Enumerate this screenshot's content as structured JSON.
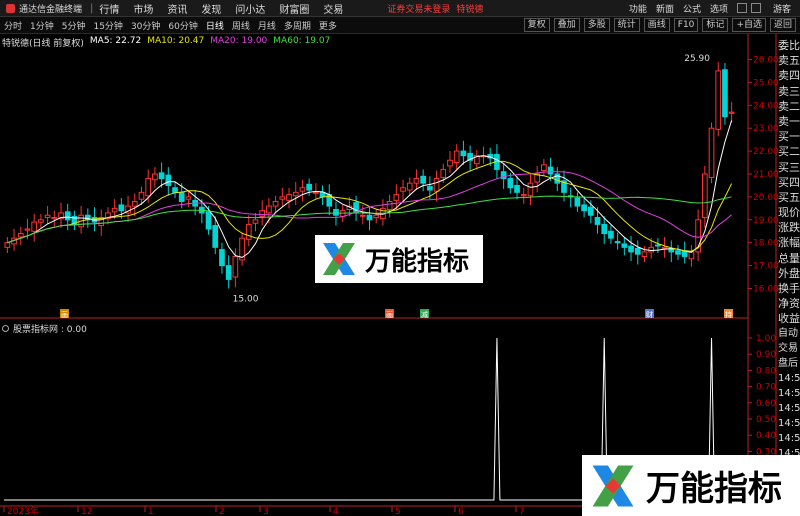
{
  "app": {
    "title": "通达信金融终端"
  },
  "menu": [
    "行情",
    "市场",
    "资讯",
    "发现",
    "问小达",
    "财富圈",
    "交易"
  ],
  "notice": {
    "text": "证券交易未登录",
    "link": "特锐德"
  },
  "tools": [
    "功能",
    "新面",
    "公式",
    "选项"
  ],
  "user": "游客",
  "periods": [
    "分时",
    "1分钟",
    "5分钟",
    "15分钟",
    "30分钟",
    "60分钟",
    "日线",
    "周线",
    "月线",
    "多周期",
    "更多"
  ],
  "active_period": "日线",
  "toolbar_right": [
    "复权",
    "叠加",
    "多股",
    "统计",
    "画线",
    "F10",
    "标记",
    "+自选",
    "返回"
  ],
  "legend": {
    "stock": "特锐德(日线 前复权)",
    "ma5": "MA5: 22.72",
    "ma10": "MA10: 20.47",
    "ma20": "MA20: 19.00",
    "ma60": "MA60: 19.07"
  },
  "colors": {
    "up": "#ff3232",
    "down": "#00d4d4",
    "ma5": "#ffffff",
    "ma10": "#e6e600",
    "ma20": "#e040e0",
    "ma60": "#40e040"
  },
  "chart_data": [
    {
      "type": "candlestick",
      "title": "特锐德(日线 前复权)",
      "ylim": [
        15.5,
        26.5
      ],
      "y_ticks": [
        "26.00",
        "25.00",
        "24.00",
        "23.00",
        "22.00",
        "21.00",
        "20.00",
        "19.00",
        "18.00",
        "17.00",
        "16.00"
      ],
      "annotations": [
        {
          "label": "25.90",
          "type": "max"
        },
        {
          "label": "15.00",
          "type": "min"
        }
      ],
      "series_close": [
        18.0,
        18.2,
        18.4,
        18.6,
        18.9,
        19.0,
        19.2,
        19.1,
        19.3,
        19.0,
        18.8,
        19.2,
        19.0,
        18.9,
        19.1,
        19.3,
        19.5,
        19.4,
        19.6,
        19.8,
        20.2,
        20.8,
        21.0,
        20.8,
        20.5,
        20.2,
        19.8,
        20.0,
        19.6,
        19.3,
        18.6,
        17.8,
        17.0,
        16.4,
        17.4,
        18.2,
        18.8,
        19.0,
        19.4,
        19.6,
        19.8,
        20.0,
        20.1,
        20.2,
        20.4,
        20.3,
        20.2,
        20.0,
        19.6,
        19.2,
        19.4,
        19.6,
        19.3,
        19.2,
        19.0,
        19.2,
        19.5,
        19.8,
        20.1,
        20.4,
        20.6,
        20.8,
        20.6,
        20.3,
        20.8,
        21.2,
        21.6,
        22.0,
        21.8,
        21.6,
        21.8,
        21.8,
        21.7,
        21.2,
        20.8,
        20.4,
        20.2,
        20.1,
        20.6,
        21.0,
        21.4,
        21.0,
        20.6,
        20.2,
        20.0,
        19.6,
        19.4,
        19.2,
        18.8,
        18.4,
        18.2,
        18.0,
        17.8,
        17.6,
        17.5,
        17.6,
        17.8,
        17.9,
        17.8,
        17.6,
        17.5,
        17.4,
        17.6,
        19.0,
        21.0,
        23.0,
        25.5,
        23.5,
        23.7
      ]
    },
    {
      "type": "line",
      "title": "股票指标网",
      "ylim": [
        0,
        1
      ],
      "y_ticks": [
        "1.00",
        "0.90",
        "0.80",
        "0.70",
        "0.60",
        "0.50",
        "0.40",
        "0.30",
        "0.20",
        "0.10"
      ],
      "value_label": "0.00",
      "spikes_at": [
        73,
        89,
        105
      ]
    }
  ],
  "x_axis": [
    "2023年",
    "12",
    "1",
    "2",
    "3",
    "4",
    "5",
    "6",
    "7"
  ],
  "indicator_label": "股票指标网 : 0.00",
  "right_labels": [
    "委比",
    "卖五",
    "卖四",
    "卖三",
    "卖二",
    "卖一",
    "买一",
    "买二",
    "买三",
    "买四",
    "买五",
    "现价",
    "涨跌",
    "涨幅",
    "总量",
    "外盘",
    "换手",
    "净资",
    "收益"
  ],
  "right_labels_2": [
    "自动",
    "交易",
    "盘后",
    "14:5",
    "14:5",
    "14:5",
    "14:5",
    "14:5",
    "14:5",
    "14:5",
    "14:5",
    "14:5"
  ],
  "watermark": "万能指标",
  "markers": [
    "画",
    "减",
    "财",
    "持"
  ]
}
